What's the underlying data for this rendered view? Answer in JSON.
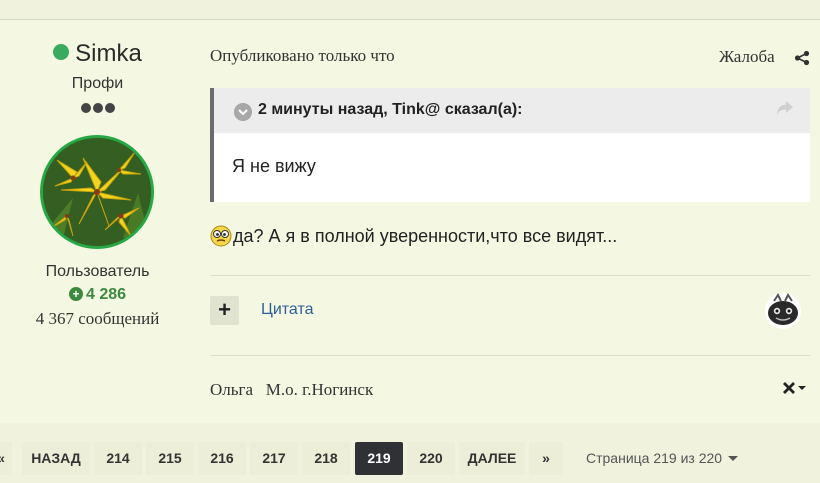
{
  "author": {
    "name": "Simka",
    "rank": "Профи",
    "group": "Пользователь",
    "reputation": "4 286",
    "post_count": "4 367 сообщений",
    "status_color": "#3aaa5e"
  },
  "post": {
    "meta": "Опубликовано только что",
    "report_label": "Жалоба",
    "quote": {
      "citation": "2 минуты назад, Tink@ сказал(а):",
      "body": "Я не вижу"
    },
    "content": "да? А я в полной уверенности,что все видят...",
    "quote_button": "Цитата",
    "signature": "Ольга   М.о. г.Ногинск"
  },
  "pagination": {
    "first_label": "«",
    "prev_label": "НАЗАД",
    "pages": [
      "214",
      "215",
      "216",
      "217",
      "218",
      "219",
      "220"
    ],
    "current": "219",
    "next_label": "ДАЛЕЕ",
    "last_label": "»",
    "info": "Страница 219 из 220"
  },
  "icons": {
    "online": "online-status-icon",
    "share": "share-icon",
    "quote_toggle": "chevron-down-icon",
    "quote_link": "reply-arrow-icon",
    "smiley": "confused-smiley-icon",
    "signature_toggle": "close-icon"
  }
}
